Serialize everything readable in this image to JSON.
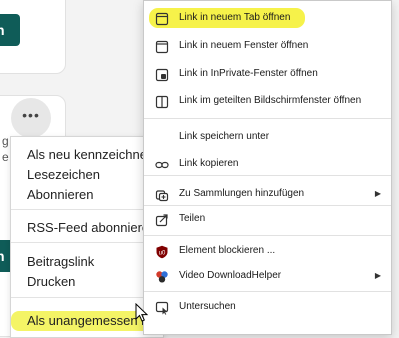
{
  "background": {
    "more_button_glyph": "•••",
    "fragment_g": "g",
    "fragment_e": "e f"
  },
  "site_menu": {
    "items": [
      "Als neu kennzeichnen",
      "Lesezeichen",
      "Abonnieren",
      "RSS-Feed abonnieren",
      "Beitragslink",
      "Drucken",
      "Als unangemessen m"
    ],
    "highlight_color": "#f4f466"
  },
  "context_menu": {
    "items": [
      {
        "label": "Link in neuem Tab öffnen",
        "icon": "new-tab-icon"
      },
      {
        "label": "Link in neuem Fenster öffnen",
        "icon": "new-window-icon"
      },
      {
        "label": "Link in InPrivate-Fenster öffnen",
        "icon": "inprivate-window-icon"
      },
      {
        "label": "Link im geteilten Bildschirmfenster öffnen",
        "icon": "split-screen-icon"
      },
      {
        "label": "Link speichern unter",
        "icon": ""
      },
      {
        "label": "Link kopieren",
        "icon": "link-icon"
      },
      {
        "label": "Zu Sammlungen hinzufügen",
        "icon": "collections-icon",
        "submenu": true
      },
      {
        "label": "Teilen",
        "icon": "share-icon"
      },
      {
        "label": "Element blockieren ...",
        "icon": "ublock-icon"
      },
      {
        "label": "Video DownloadHelper",
        "icon": "video-downloadhelper-icon",
        "submenu": true
      },
      {
        "label": "Untersuchen",
        "icon": "inspect-icon"
      }
    ],
    "submenu_glyph": "▶",
    "highlight_color": "#f6f24a"
  },
  "colors": {
    "teal_button": "#0f5c58",
    "ublock_red": "#800000"
  }
}
